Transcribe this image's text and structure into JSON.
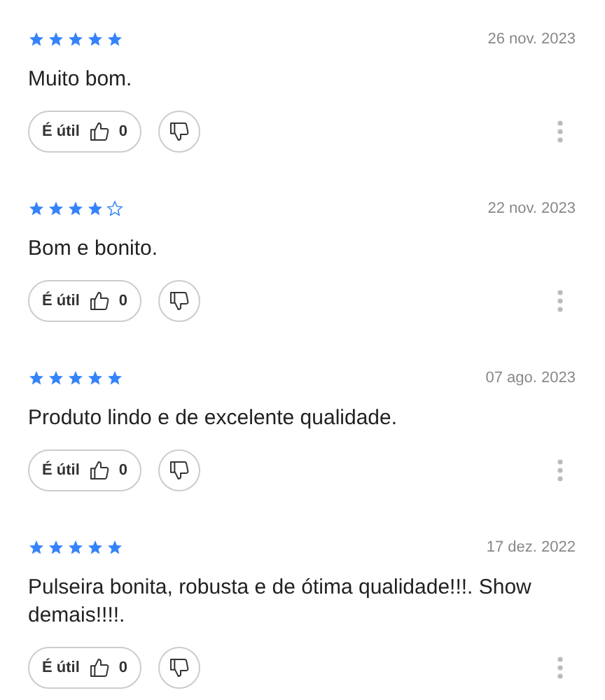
{
  "reviews": [
    {
      "stars": 5,
      "date": "26 nov. 2023",
      "text": "Muito bom.",
      "helpful_label": "É útil",
      "helpful_count": "0"
    },
    {
      "stars": 4,
      "date": "22 nov. 2023",
      "text": "Bom e bonito.",
      "helpful_label": "É útil",
      "helpful_count": "0"
    },
    {
      "stars": 5,
      "date": "07 ago. 2023",
      "text": "Produto lindo e de excelente qualidade.",
      "helpful_label": "É útil",
      "helpful_count": "0"
    },
    {
      "stars": 5,
      "date": "17 dez. 2022",
      "text": "Pulseira bonita, robusta e de ótima qualidade!!!. Show demais!!!!.",
      "helpful_label": "É útil",
      "helpful_count": "0"
    }
  ]
}
